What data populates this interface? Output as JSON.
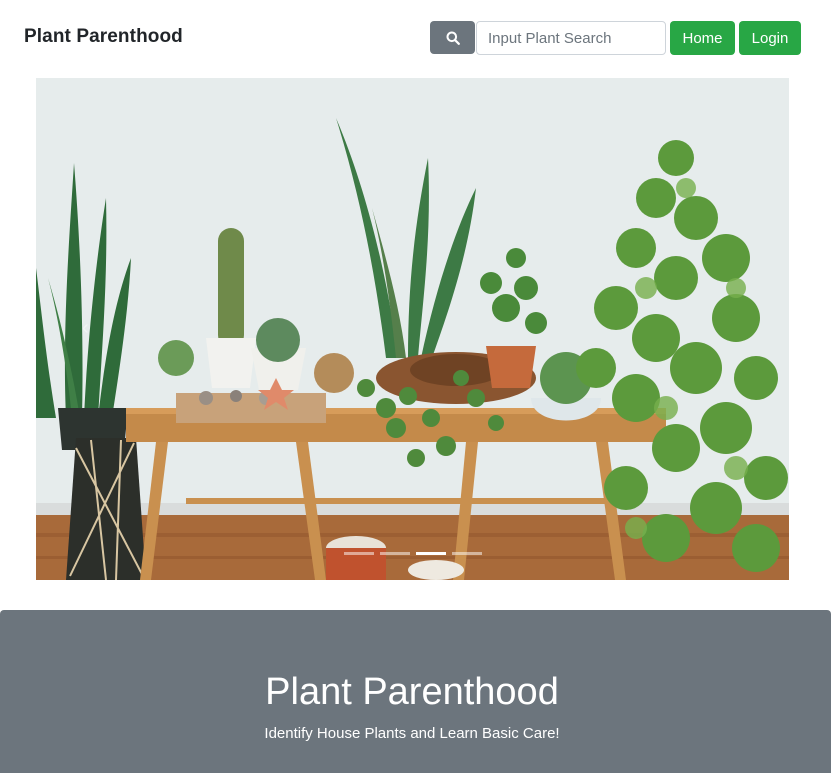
{
  "navbar": {
    "brand": "Plant Parenthood",
    "search_icon": "search-icon",
    "search_placeholder": "Input Plant Search",
    "home_label": "Home",
    "login_label": "Login"
  },
  "carousel": {
    "image": "houseplants-on-wooden-bench-photo",
    "active_slide": 3,
    "slide_count": 4
  },
  "jumbotron": {
    "title": "Plant Parenthood",
    "subtitle": "Identify House Plants and Learn Basic Care!"
  },
  "colors": {
    "accent_green": "#28a745",
    "secondary_gray": "#6c757d"
  }
}
